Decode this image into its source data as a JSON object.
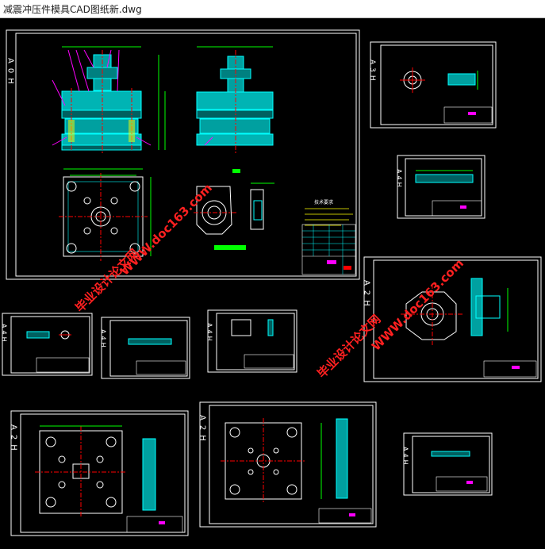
{
  "window": {
    "title": "减震冲压件模具CAD图纸新.dwg"
  },
  "sheets": {
    "a0": "A0H",
    "a3": "A3H",
    "a4_1": "A4H",
    "a2_right": "A2H",
    "a4_2": "A4H",
    "a4_3": "A4H",
    "a4_4": "A4H",
    "a2_bottom_left": "A2H",
    "a2_bottom_mid": "A2H",
    "a4_5": "A4H"
  },
  "tech_title": "技术要求",
  "watermark": {
    "site": "WWW.doc163.com",
    "brand": "毕业设计论文网"
  },
  "colors": {
    "background": "#000000",
    "frame": "#ffffff",
    "geometry": "#00ffff",
    "dimension": "#00ff00",
    "center": "#ff0000",
    "leader": "#ff00ff",
    "note": "#ffff00",
    "watermark_red": "#ff2020"
  }
}
